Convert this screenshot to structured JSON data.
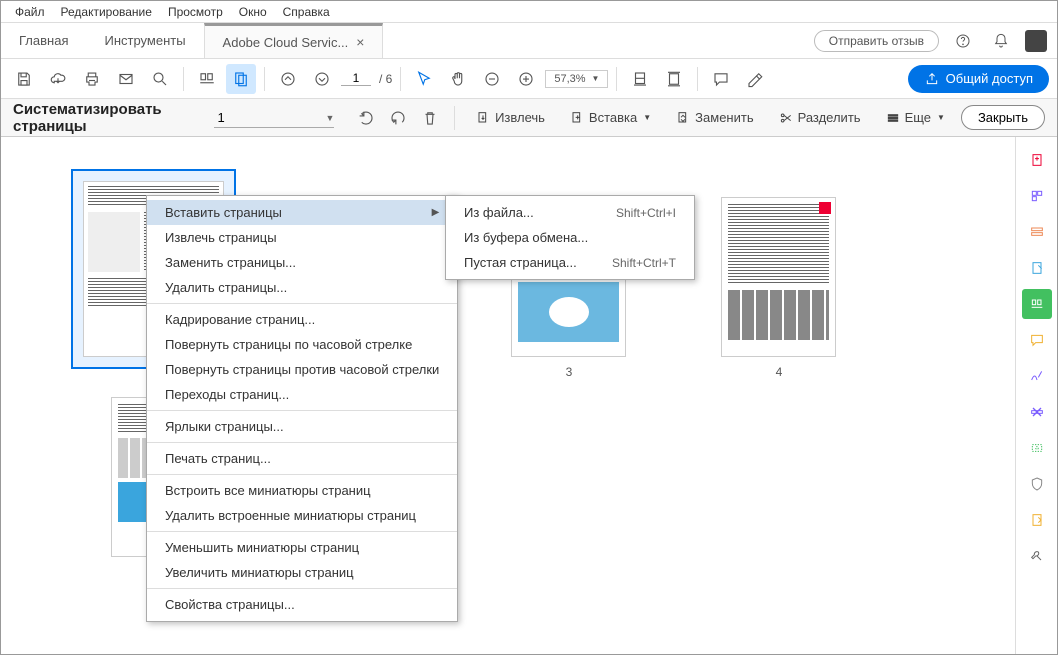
{
  "menubar": [
    "Файл",
    "Редактирование",
    "Просмотр",
    "Окно",
    "Справка"
  ],
  "tabs": {
    "home": "Главная",
    "tools": "Инструменты",
    "doc": "Adobe Cloud Servic..."
  },
  "feedback": "Отправить отзыв",
  "toolbar": {
    "page_current": "1",
    "page_total": "/ 6",
    "zoom": "57,3%"
  },
  "share": "Общий доступ",
  "sectoolbar": {
    "title": "Систематизировать страницы",
    "page_sel": "1",
    "extract": "Извлечь",
    "insert": "Вставка",
    "replace": "Заменить",
    "split": "Разделить",
    "more": "Еще",
    "close": "Закрыть"
  },
  "thumbs": {
    "p3": "3",
    "p4": "4"
  },
  "context": {
    "insert_pages": "Вставить страницы",
    "extract_pages": "Извлечь страницы",
    "replace_pages": "Заменить страницы...",
    "delete_pages": "Удалить страницы...",
    "crop_pages": "Кадрирование страниц...",
    "rotate_cw": "Повернуть страницы по часовой стрелке",
    "rotate_ccw": "Повернуть страницы против часовой стрелки",
    "transitions": "Переходы страниц...",
    "labels": "Ярлыки страницы...",
    "print": "Печать страниц...",
    "embed_all": "Встроить все миниатюры страниц",
    "remove_embedded": "Удалить встроенные миниатюры страниц",
    "reduce_thumbs": "Уменьшить миниатюры страниц",
    "enlarge_thumbs": "Увеличить миниатюры страниц",
    "properties": "Свойства страницы..."
  },
  "submenu": {
    "from_file": "Из файла...",
    "from_file_sc": "Shift+Ctrl+I",
    "from_clipboard": "Из буфера обмена...",
    "blank_page": "Пустая страница...",
    "blank_page_sc": "Shift+Ctrl+T"
  }
}
